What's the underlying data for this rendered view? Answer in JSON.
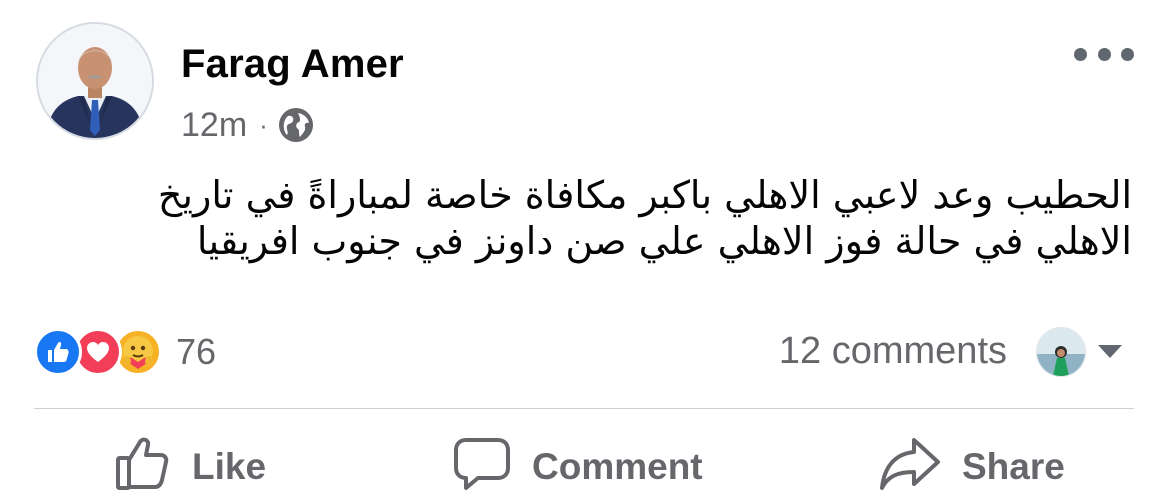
{
  "post": {
    "author": "Farag Amer",
    "time": "12m",
    "separator": "·",
    "privacy_icon": "globe-icon",
    "more_icon": "more-dots-icon",
    "text_lines": [
      "الحطيب وعد لاعبي الاهلي باكبر مكافاة خاصة  لمباراةً في تاريخ",
      "الاهلي في حالة فوز الاهلي علي صن داونز في جنوب افريقيا"
    ]
  },
  "reactions": {
    "icons": [
      "like-reaction-icon",
      "love-reaction-icon",
      "care-reaction-icon"
    ],
    "count": "76"
  },
  "comments": {
    "count_label": "12 comments"
  },
  "actions": {
    "like_label": "Like",
    "comment_label": "Comment",
    "share_label": "Share"
  },
  "colors": {
    "like_blue": "#1877f2",
    "love_red": "#f33e58",
    "care_yellow": "#f7b125",
    "secondary_text": "#65676b",
    "divider": "#ced0d4"
  }
}
